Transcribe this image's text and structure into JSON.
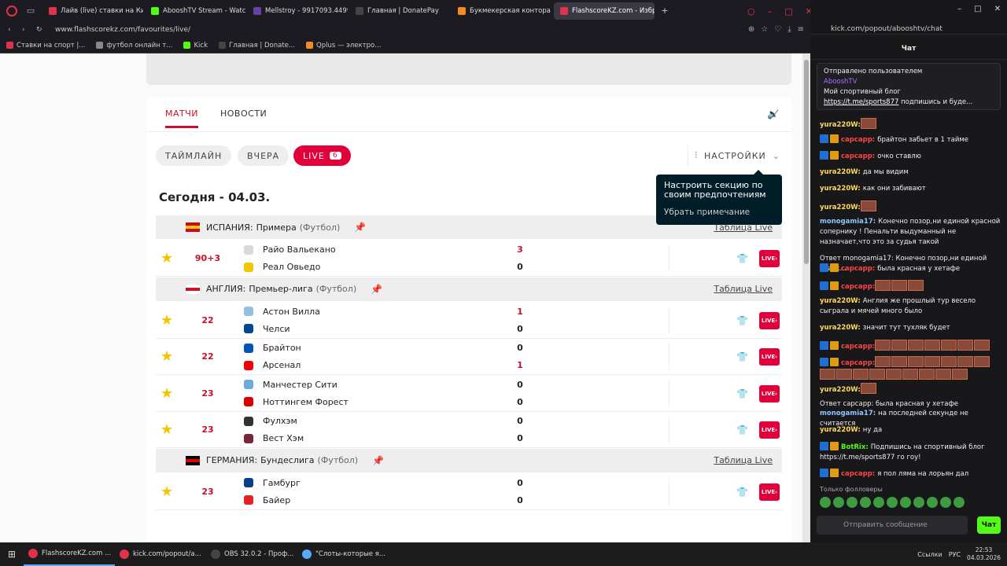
{
  "browser": {
    "tabs": [
      {
        "label": "Лайв (live) ставки на Киб",
        "color": "#e0334b",
        "active": false
      },
      {
        "label": "AbooshTV Stream - Watc",
        "color": "#53fc18",
        "active": false
      },
      {
        "label": "Mellstroy - 9917093.4499",
        "color": "#6441a5",
        "active": false
      },
      {
        "label": "Главная | DonatePay",
        "color": "#444444",
        "active": false
      },
      {
        "label": "Букмекерская контора B",
        "color": "#f28b24",
        "active": false
      },
      {
        "label": "FlashscoreKZ.com - Избр",
        "color": "#e0334b",
        "active": true
      }
    ],
    "url": "www.flashscorekz.com/favourites/live/",
    "bookmarks": [
      {
        "label": "Ставки на спорт |...",
        "color": "#e0334b"
      },
      {
        "label": "футбол онлайн т...",
        "color": "#888888"
      },
      {
        "label": "Kick",
        "color": "#53fc18"
      },
      {
        "label": "Главная | Donate...",
        "color": "#444444"
      },
      {
        "label": "Qplus — электро...",
        "color": "#f28b24"
      }
    ]
  },
  "page": {
    "nav": {
      "matches": "МАТЧИ",
      "news": "НОВОСТИ"
    },
    "filters": {
      "timeline": "ТАЙМЛАЙН",
      "yesterday": "ВЧЕРА",
      "live": "LIVE",
      "live_count": "6"
    },
    "settings_label": "НАСТРОЙКИ",
    "tooltip": {
      "text": "Настроить секцию по своим предпочтениям",
      "dismiss": "Убрать примечание"
    },
    "date": "Сегодня - 04.03.",
    "table_live": "Таблица Live",
    "live_button": "LIVE›",
    "leagues": [
      {
        "country": "ИСПАНИЯ:",
        "name": "Примера",
        "sport": "(Футбол)",
        "flag_colors": [
          "#c60b1e",
          "#ffc400"
        ],
        "matches": [
          {
            "minute": "90+3",
            "home": "Райо Вальекано",
            "away": "Реал Овьедо",
            "home_score": "3",
            "away_score": "0",
            "home_color": "#d9d9d9",
            "away_color": "#f5c400"
          }
        ]
      },
      {
        "country": "АНГЛИЯ:",
        "name": "Премьер-лига",
        "sport": "(Футбол)",
        "flag_colors": [
          "#ffffff",
          "#ce1124"
        ],
        "matches": [
          {
            "minute": "22",
            "home": "Астон Вилла",
            "away": "Челси",
            "home_score": "1",
            "away_score": "0",
            "home_color": "#95bfe5",
            "away_color": "#034694"
          },
          {
            "minute": "22",
            "home": "Брайтон",
            "away": "Арсенал",
            "home_score": "0",
            "away_score": "1",
            "home_color": "#0057b8",
            "away_color": "#ef0107"
          },
          {
            "minute": "23",
            "home": "Манчестер Сити",
            "away": "Ноттингем Форест",
            "home_score": "0",
            "away_score": "0",
            "home_color": "#6cabdd",
            "away_color": "#dd0000"
          },
          {
            "minute": "23",
            "home": "Фулхэм",
            "away": "Вест Хэм",
            "home_score": "0",
            "away_score": "0",
            "home_color": "#333333",
            "away_color": "#7a263a"
          }
        ]
      },
      {
        "country": "ГЕРМАНИЯ:",
        "name": "Бундеслига",
        "sport": "(Футбол)",
        "flag_colors": [
          "#000000",
          "#dd0000"
        ],
        "matches": [
          {
            "minute": "23",
            "home": "Гамбург",
            "away": "Байер",
            "home_score": "0",
            "away_score": "0",
            "home_color": "#0a3f86",
            "away_color": "#e32221"
          }
        ]
      }
    ]
  },
  "chat": {
    "url": "kick.com/popout/abooshtv/chat",
    "title": "Чат",
    "pinned": {
      "header": "Отправлено пользователем",
      "user": "AbooshTV",
      "text": "Мой спортивный блог",
      "link": "https://t.me/sports877",
      "suffix": "подпишись и буде..."
    },
    "messages": [
      {
        "user": "yura220W:",
        "color": "#ffd95a",
        "text": "",
        "emotes": 1,
        "badges": false
      },
      {
        "user": "сарсарр:",
        "color": "#ff4444",
        "text": "брайтон забьет в 1 тайме",
        "emotes": 0,
        "badges": true
      },
      {
        "user": "сарсарр:",
        "color": "#ff4444",
        "text": "очко ставлю",
        "emotes": 0,
        "badges": true
      },
      {
        "user": "yura220W:",
        "color": "#ffd95a",
        "text": "да мы видим",
        "emotes": 0,
        "badges": false
      },
      {
        "user": "yura220W:",
        "color": "#ffd95a",
        "text": "как они забивают",
        "emotes": 0,
        "badges": false
      },
      {
        "user": "yura220W:",
        "color": "#ffd95a",
        "text": "",
        "emotes": 1,
        "badges": false
      },
      {
        "user": "monogamia17:",
        "color": "#8cc8ff",
        "text": "Конечно позор,ни единой красной сопернику ! Пенальти выдуманный не назначает,что это за судья такой",
        "emotes": 0,
        "badges": false
      },
      {
        "reply": "Ответ monogamia17: Конечно позор,ни единой краск...",
        "user": "сарсарр:",
        "color": "#ff4444",
        "text": "была красная у хетафе",
        "emotes": 0,
        "badges": true
      },
      {
        "user": "сарсарр:",
        "color": "#ff4444",
        "text": "",
        "emotes": 3,
        "badges": true
      },
      {
        "user": "yura220W:",
        "color": "#ffd95a",
        "text": "Англия же прошлый тур весело сыграла и мячей много было",
        "emotes": 0,
        "badges": false
      },
      {
        "user": "yura220W:",
        "color": "#ffd95a",
        "text": "значит тут тухляк будет",
        "emotes": 0,
        "badges": false
      },
      {
        "user": "сарсарр:",
        "color": "#ff4444",
        "text": "",
        "emotes": 7,
        "badges": true
      },
      {
        "user": "сарсарр:",
        "color": "#ff4444",
        "text": "",
        "emotes": 16,
        "badges": true
      },
      {
        "user": "yura220W:",
        "color": "#ffd95a",
        "text": "",
        "emotes": 1,
        "badges": false
      },
      {
        "reply": "Ответ сарсарр: была красная у хетафе",
        "user": "monogamia17:",
        "color": "#8cc8ff",
        "text": "на последней секунде не считается",
        "emotes": 0,
        "badges": false
      },
      {
        "user": "yura220W:",
        "color": "#ffd95a",
        "text": "ну да",
        "emotes": 0,
        "badges": false
      },
      {
        "user": "BotRix:",
        "color": "#53fc18",
        "text": "Подпишись на спортивный блог https://t.me/sports877 го гоу!",
        "emotes": 0,
        "badges": true
      },
      {
        "user": "сарсарр:",
        "color": "#ff4444",
        "text": "я пол ляма на лорьян дал",
        "emotes": 0,
        "badges": true
      }
    ],
    "followers_only": "Только фолловеры",
    "input_placeholder": "Отправить сообщение",
    "send_label": "Чат"
  },
  "taskbar": {
    "items": [
      {
        "label": "FlashscoreKZ.com ...",
        "color": "#e0334b"
      },
      {
        "label": "kick.com/popout/a...",
        "color": "#e0334b"
      },
      {
        "label": "OBS 32.0.2 - Проф...",
        "color": "#444444"
      },
      {
        "label": "\"Слоты-которые я...",
        "color": "#5aa7ff"
      }
    ],
    "tray_links": "Ссылки",
    "lang": "РУС",
    "time": "22:53",
    "date": "04.03.2026"
  }
}
